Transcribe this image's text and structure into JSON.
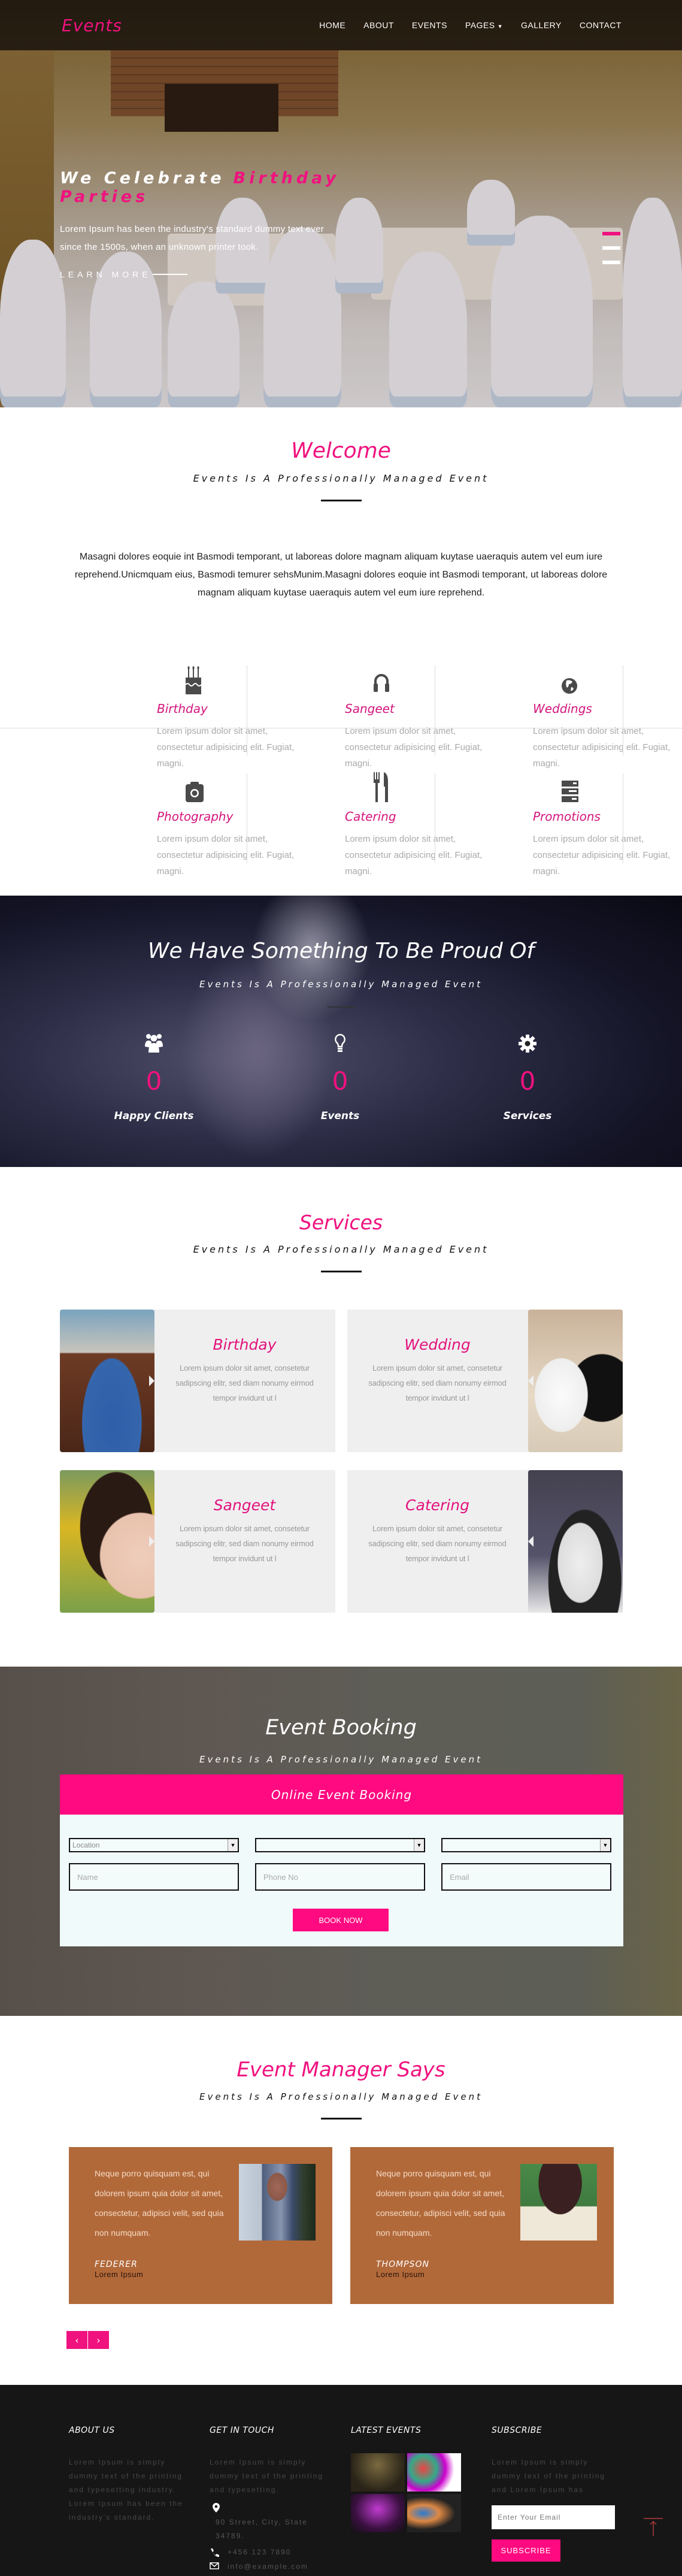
{
  "nav": {
    "logo": "Events",
    "items": [
      {
        "label": "HOME"
      },
      {
        "label": "ABOUT"
      },
      {
        "label": "EVENTS"
      },
      {
        "label": "PAGES",
        "has_dropdown": true
      },
      {
        "label": "GALLERY"
      },
      {
        "label": "CONTACT"
      }
    ]
  },
  "hero": {
    "title_plain": "We Celebrate",
    "title_accent": "Birthday Parties",
    "description": "Lorem Ipsum has been the industry's standard dummy text ever since the 1500s, when an unknown printer took.",
    "cta": "LEARN MORE",
    "slides_total": 3,
    "active_slide": 1
  },
  "welcome": {
    "title": "Welcome",
    "subtitle": "Events Is A Professionally Managed Event",
    "text": "Masagni dolores eoquie int Basmodi temporant, ut laboreas dolore magnam aliquam kuytase uaeraquis autem vel eum iure reprehend.Unicmquam eius, Basmodi temurer sehsMunim.Masagni dolores eoquie int Basmodi temporant, ut laboreas dolore magnam aliquam kuytase uaeraquis autem vel eum iure reprehend."
  },
  "features": [
    {
      "icon": "birthday-cake-icon",
      "title": "Birthday",
      "text": "Lorem ipsum dolor sit amet, consectetur adipisicing elit. Fugiat, magni."
    },
    {
      "icon": "headphones-icon",
      "title": "Sangeet",
      "text": "Lorem ipsum dolor sit amet, consectetur adipisicing elit. Fugiat, magni."
    },
    {
      "icon": "globe-icon",
      "title": "Weddings",
      "text": "Lorem ipsum dolor sit amet, consectetur adipisicing elit. Fugiat, magni."
    },
    {
      "icon": "camera-icon",
      "title": "Photography",
      "text": "Lorem ipsum dolor sit amet, consectetur adipisicing elit. Fugiat, magni."
    },
    {
      "icon": "cutlery-icon",
      "title": "Catering",
      "text": "Lorem ipsum dolor sit amet, consectetur adipisicing elit. Fugiat, magni."
    },
    {
      "icon": "server-icon",
      "title": "Promotions",
      "text": "Lorem ipsum dolor sit amet, consectetur adipisicing elit. Fugiat, magni."
    }
  ],
  "proud": {
    "title": "We Have Something To Be Proud Of",
    "subtitle": "Events Is A Professionally Managed Event",
    "stats": [
      {
        "icon": "users-icon",
        "value": "0",
        "label": "Happy Clients"
      },
      {
        "icon": "lightbulb-icon",
        "value": "0",
        "label": "Events"
      },
      {
        "icon": "gear-icon",
        "value": "0",
        "label": "Services"
      }
    ]
  },
  "services": {
    "title": "Services",
    "subtitle": "Events Is A Professionally Managed Event",
    "items": [
      {
        "title": "Birthday",
        "text": "Lorem ipsum dolor sit amet, consetetur sadipscing elitr, sed diam nonumy eirmod tempor invidunt ut l"
      },
      {
        "title": "Wedding",
        "text": "Lorem ipsum dolor sit amet, consetetur sadipscing elitr, sed diam nonumy eirmod tempor invidunt ut l"
      },
      {
        "title": "Sangeet",
        "text": "Lorem ipsum dolor sit amet, consetetur sadipscing elitr, sed diam nonumy eirmod tempor invidunt ut l"
      },
      {
        "title": "Catering",
        "text": "Lorem ipsum dolor sit amet, consetetur sadipscing elitr, sed diam nonumy eirmod tempor invidunt ut l"
      }
    ]
  },
  "booking": {
    "title": "Event Booking",
    "subtitle": "Events Is A Professionally Managed Event",
    "form_title": "Online Event Booking",
    "selects": [
      {
        "value": "Location"
      },
      {
        "value": ""
      },
      {
        "value": ""
      }
    ],
    "inputs": [
      {
        "placeholder": "Name"
      },
      {
        "placeholder": "Phone No"
      },
      {
        "placeholder": "Email"
      }
    ],
    "submit": "BOOK NOW"
  },
  "testimonials": {
    "title": "Event Manager Says",
    "subtitle": "Events Is A Professionally Managed Event",
    "items": [
      {
        "quote": "Neque porro quisquam est, qui dolorem ipsum quia dolor sit amet, consectetur, adipisci velit, sed quia non numquam.",
        "name": "FEDERER",
        "role": "Lorem Ipsum"
      },
      {
        "quote": "Neque porro quisquam est, qui dolorem ipsum quia dolor sit amet, consectetur, adipisci velit, sed quia non numquam.",
        "name": "THOMPSON",
        "role": "Lorem Ipsum"
      }
    ],
    "prev": "‹",
    "next": "›"
  },
  "footer": {
    "about": {
      "title": "ABOUT US",
      "text": "Lorem Ipsum is simply dummy text of the printing and typesetting industry. Lorem Ipsum has been the industry's standard."
    },
    "contact": {
      "title": "GET IN TOUCH",
      "text": "Lorem Ipsum is simply dummy text of the printing and typesetting.",
      "address": "90 Street, City, State 34789.",
      "phone": "+456 123 7890",
      "email": "info@example.com"
    },
    "latest": {
      "title": "LATEST EVENTS"
    },
    "subscribe": {
      "title": "SUBSCRIBE",
      "text": "Lorem Ipsum is simply dummy text of the printing and Lorem Ipsum has",
      "placeholder": "Enter Your Email",
      "button": "SUBSCRIBE"
    }
  },
  "colors": {
    "accent": "#f0127f",
    "testimonial_bg": "#b2693a",
    "footer_bg": "#161616",
    "booking_form_bg": "#f0fafb"
  }
}
